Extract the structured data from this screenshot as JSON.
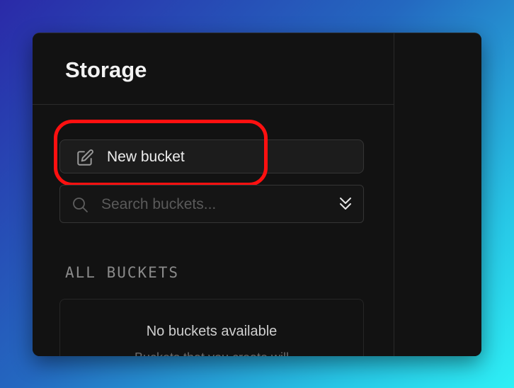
{
  "sidebar": {
    "title": "Storage",
    "new_bucket_label": "New bucket",
    "search_placeholder": "Search buckets...",
    "section_label": "ALL BUCKETS",
    "empty_title": "No buckets available",
    "empty_subtitle": "Buckets that you create will"
  },
  "icons": {
    "new_bucket": "edit-icon",
    "search": "search-icon",
    "expand": "chevrons-down-icon"
  },
  "colors": {
    "highlight": "#ff1010",
    "panel": "#121212"
  }
}
